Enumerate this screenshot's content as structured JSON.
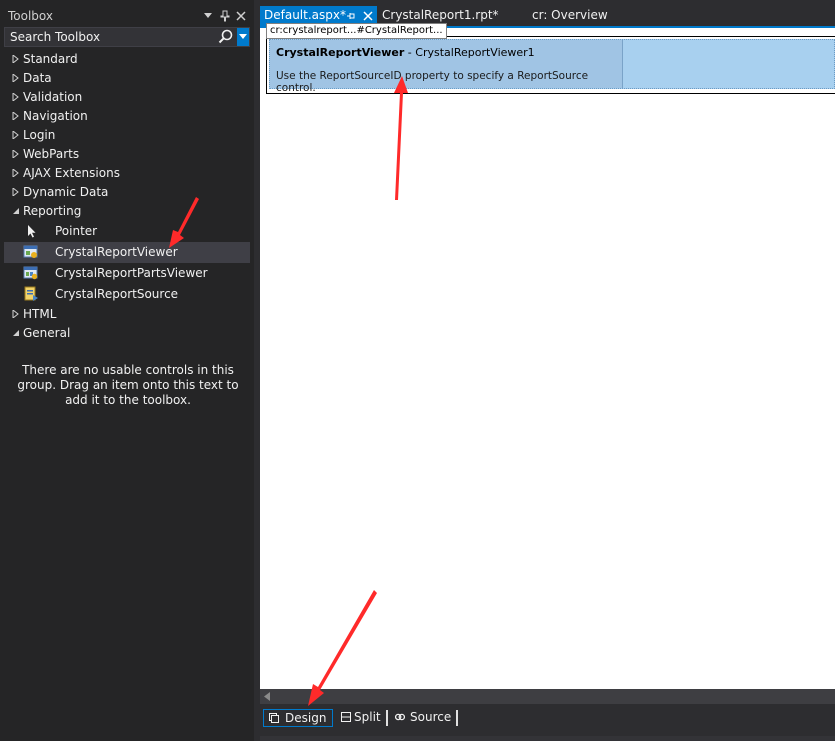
{
  "toolbox": {
    "title": "Toolbox",
    "search_placeholder": "Search Toolbox",
    "groups_before": [
      {
        "label": "Standard"
      },
      {
        "label": "Data"
      },
      {
        "label": "Validation"
      },
      {
        "label": "Navigation"
      },
      {
        "label": "Login"
      },
      {
        "label": "WebParts"
      },
      {
        "label": "AJAX Extensions"
      },
      {
        "label": "Dynamic Data"
      }
    ],
    "reporting": {
      "label": "Reporting",
      "items": [
        {
          "label": "Pointer",
          "icon": "pointer-icon"
        },
        {
          "label": "CrystalReportViewer",
          "icon": "crystal-report-viewer-icon",
          "selected": true
        },
        {
          "label": "CrystalReportPartsViewer",
          "icon": "crystal-report-parts-viewer-icon"
        },
        {
          "label": "CrystalReportSource",
          "icon": "crystal-report-source-icon"
        }
      ]
    },
    "html_group": "HTML",
    "general_group": "General",
    "empty_message": "There are no usable controls in this group. Drag an item onto this text to add it to the toolbox."
  },
  "tabs": [
    {
      "label": "Default.aspx*",
      "active": true
    },
    {
      "label": "CrystalReport1.rpt*",
      "active": false
    },
    {
      "label": "cr: Overview",
      "active": false
    }
  ],
  "designer": {
    "breadcrumb": "cr:crystalreport...#CrystalReport...",
    "control_name": "CrystalReportViewer",
    "control_id": " - CrystalReportViewer1",
    "control_hint": "Use the ReportSourceID property to specify a ReportSource control."
  },
  "view_buttons": [
    {
      "label": "Design",
      "active": true
    },
    {
      "label": "Split",
      "active": false
    },
    {
      "label": "Source",
      "active": false
    }
  ],
  "colors": {
    "accent": "#007acc",
    "annotation_arrow": "#ff2a2a",
    "control_highlight": "#a0c4e4"
  }
}
